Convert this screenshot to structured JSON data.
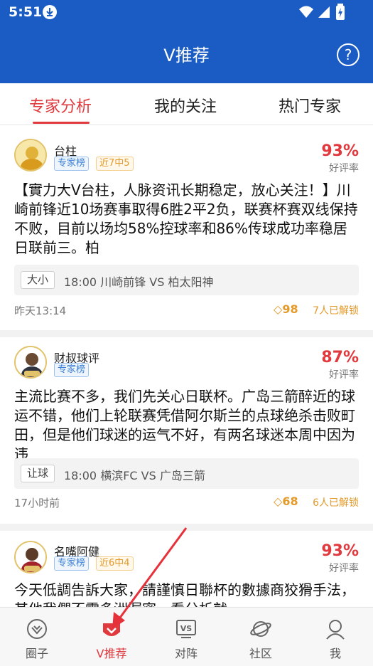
{
  "status_bar": {
    "time": "5:51"
  },
  "header": {
    "title": "V推荐",
    "help": "?"
  },
  "tabs": [
    {
      "label": "专家分析",
      "active": true
    },
    {
      "label": "我的关注",
      "active": false
    },
    {
      "label": "热门专家",
      "active": false
    }
  ],
  "posts": [
    {
      "author": "台柱",
      "badges": [
        "专家榜",
        "近7中5"
      ],
      "rating": "93%",
      "rating_label": "好评率",
      "text": "【實力大V台柱，人脉资讯长期稳定，放心关注！】川崎前锋近10场赛事取得6胜2平2负，联赛杯赛双线保持不败，目前以场均58%控球率和86%传球成功率稳居日联前三。柏",
      "match_tag": "大小",
      "match": "18:00 川崎前锋 VS 柏太阳神",
      "time": "昨天13:14",
      "price": "98",
      "unlocked": "7人已解锁"
    },
    {
      "author": "财叔球评",
      "badges": [
        "专家榜"
      ],
      "rating": "87%",
      "rating_label": "好评率",
      "text": "主流比赛不多，我们先关心日联杯。广岛三箭醉近的球运不错，他们上轮联赛凭借阿尔斯兰的点球绝杀击败町田，但是他们球迷的运气不好，有两名球迷本周中因为违",
      "match_tag": "让球",
      "match": "18:00 横滨FC VS 广岛三箭",
      "time": "17小时前",
      "price": "68",
      "unlocked": "6人已解锁"
    },
    {
      "author": "名嘴阿健",
      "badges": [
        "专家榜",
        "近6中4"
      ],
      "rating": "93%",
      "rating_label": "好评率",
      "text": "今天低調告訴大家，請謹慎日聯杯的數據商狡猾手法，其他我們不需多洲漏密，看分析就"
    }
  ],
  "bottom_nav": [
    {
      "label": "圈子",
      "icon": "circle-icon",
      "active": false
    },
    {
      "label": "V推荐",
      "icon": "v-recommend-icon",
      "active": true
    },
    {
      "label": "对阵",
      "icon": "vs-icon",
      "active": false
    },
    {
      "label": "社区",
      "icon": "planet-icon",
      "active": false
    },
    {
      "label": "我",
      "icon": "user-icon",
      "active": false
    }
  ],
  "colors": {
    "primary": "#1a5bc4",
    "accent": "#e0393e",
    "gold": "#e39a2a"
  }
}
